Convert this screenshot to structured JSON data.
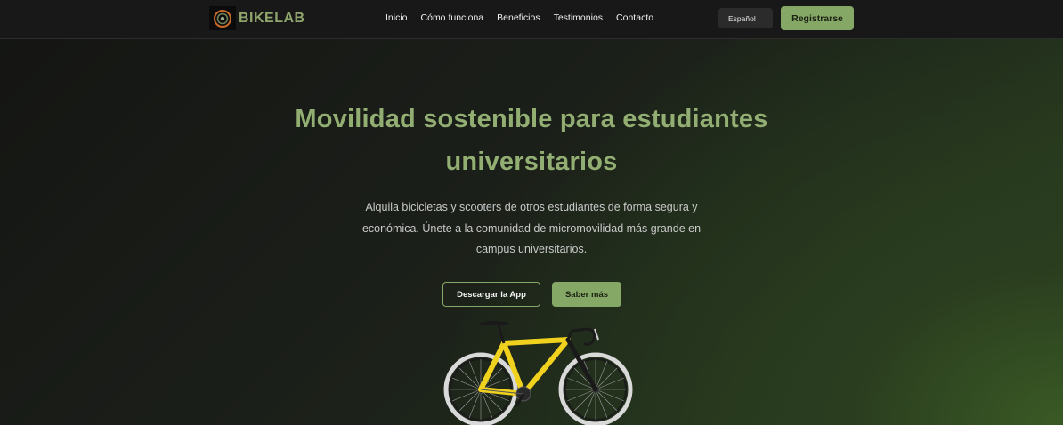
{
  "header": {
    "brand": "BIKELAB",
    "nav": [
      {
        "label": "Inicio"
      },
      {
        "label": "Cómo funciona"
      },
      {
        "label": "Beneficios"
      },
      {
        "label": "Testimonios"
      },
      {
        "label": "Contacto"
      }
    ],
    "language": "Español",
    "register_label": "Registrarse"
  },
  "hero": {
    "title_line1": "Movilidad sostenible para estudiantes",
    "title_line2": "universitarios",
    "description_line1": "Alquila bicicletas y scooters de otros estudiantes de forma segura y",
    "description_line2": "económica. Únete a la comunidad de micromovilidad más grande en",
    "description_line3": "campus universitarios.",
    "download_label": "Descargar la App",
    "more_label": "Saber más",
    "image_icon": "bicycle-image"
  },
  "colors": {
    "accent": "#86a866",
    "heading": "#93ae72",
    "nav_bg": "#181818",
    "background": "#151614"
  }
}
